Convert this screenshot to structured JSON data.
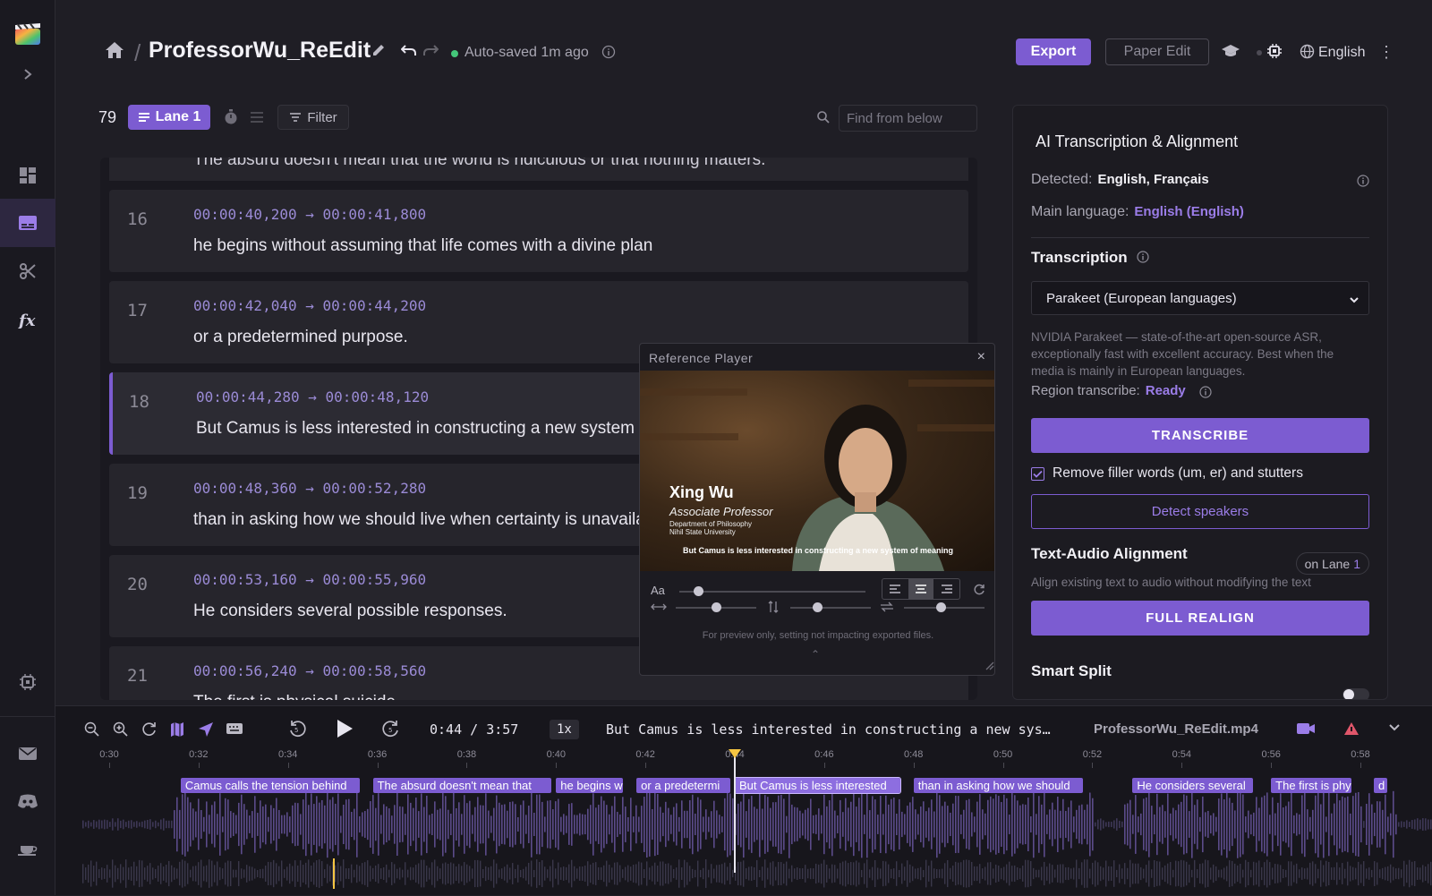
{
  "project": {
    "title": "ProfessorWu_ReEdit",
    "autosave": "Auto-saved 1m ago",
    "export_label": "Export",
    "paper_edit_label": "Paper Edit",
    "language": "English"
  },
  "toolbar": {
    "count": "79",
    "lane_label": "Lane 1",
    "filter_label": "Filter",
    "search_placeholder": "Find from below"
  },
  "subtitles": {
    "cutoff_text": "The absurd doesn't mean that the world is ridiculous or that nothing matters.",
    "cues": [
      {
        "num": "16",
        "tc": "00:00:40,200 → 00:00:41,800",
        "text": "he begins without assuming that life comes with a divine plan"
      },
      {
        "num": "17",
        "tc": "00:00:42,040 → 00:00:44,200",
        "text": "or a predetermined purpose."
      },
      {
        "num": "18",
        "tc": "00:00:44,280 → 00:00:48,120",
        "text": "But Camus is less interested in constructing a new system of meaning"
      },
      {
        "num": "19",
        "tc": "00:00:48,360 → 00:00:52,280",
        "text": "than in asking how we should live when certainty is unavailable."
      },
      {
        "num": "20",
        "tc": "00:00:53,160 → 00:00:55,960",
        "text": "He considers several possible responses."
      },
      {
        "num": "21",
        "tc": "00:00:56,240 → 00:00:58,560",
        "text": "The first is physical suicide."
      }
    ]
  },
  "player": {
    "title": "Reference Player",
    "close": "×",
    "name": "Xing Wu",
    "role": "Associate Professor",
    "dept1": "Department of Philosophy",
    "dept2": "Nihil State University",
    "subtitle": "But Camus is less interested in constructing a new system of meaning",
    "aa_label": "Aa",
    "note": "For preview only, setting not impacting exported files.",
    "font_size_level": 0.1,
    "horizontal_level": 0.5,
    "vertical_level": 0.33,
    "spacing_level": 0.45
  },
  "panel": {
    "heading": "AI Transcription & Alignment",
    "detected_label": "Detected:",
    "detected_value": "English, Français",
    "main_lang_label": "Main language:",
    "main_lang_value": "English (English)",
    "transcription_label": "Transcription",
    "model": "Parakeet (European languages)",
    "model_desc": "NVIDIA Parakeet — state-of-the-art open-source ASR, exceptionally fast with excellent accuracy. Best when the media is mainly in European languages.",
    "region_label": "Region transcribe:",
    "region_value": "Ready",
    "transcribe_btn": "TRANSCRIBE",
    "filler_label": "Remove filler words (um, er) and stutters",
    "detect_btn": "Detect speakers",
    "align_label": "Text-Audio Alignment",
    "align_lane_prefix": "on Lane",
    "align_lane_num": "1",
    "align_desc": "Align existing text to audio without modifying the text",
    "realign_btn": "FULL REALIGN",
    "smart_split_label": "Smart Split"
  },
  "timeline": {
    "time": "0:44 / 3:57",
    "speed": "1x",
    "now_text": "But Camus is less interested in constructing a new sys…",
    "file": "ProfessorWu_ReEdit.mp4",
    "ticks": [
      "0:30",
      "0:32",
      "0:34",
      "0:36",
      "0:38",
      "0:40",
      "0:42",
      "0:44",
      "0:46",
      "0:48",
      "0:50",
      "0:52",
      "0:54",
      "0:56",
      "0:58"
    ],
    "clips": [
      {
        "label": "Camus calls the tension behind",
        "start": 31.6,
        "end": 35.6
      },
      {
        "label": "The absurd doesn't mean that",
        "start": 35.9,
        "end": 39.9
      },
      {
        "label": "he begins w",
        "start": 40.0,
        "end": 41.5
      },
      {
        "label": "or a predetermi",
        "start": 41.8,
        "end": 43.9
      },
      {
        "label": "But Camus is less interested",
        "start": 44.0,
        "end": 47.7
      },
      {
        "label": "than in asking how we should",
        "start": 48.0,
        "end": 51.8
      },
      {
        "label": "He considers several",
        "start": 52.9,
        "end": 55.6
      },
      {
        "label": "The first is physic",
        "start": 56.0,
        "end": 57.8
      },
      {
        "label": "d",
        "start": 58.3,
        "end": 58.6
      }
    ],
    "playhead_time": 44.0,
    "colors": {
      "accent": "#7c5cd1",
      "playhead": "#f5c542"
    }
  }
}
